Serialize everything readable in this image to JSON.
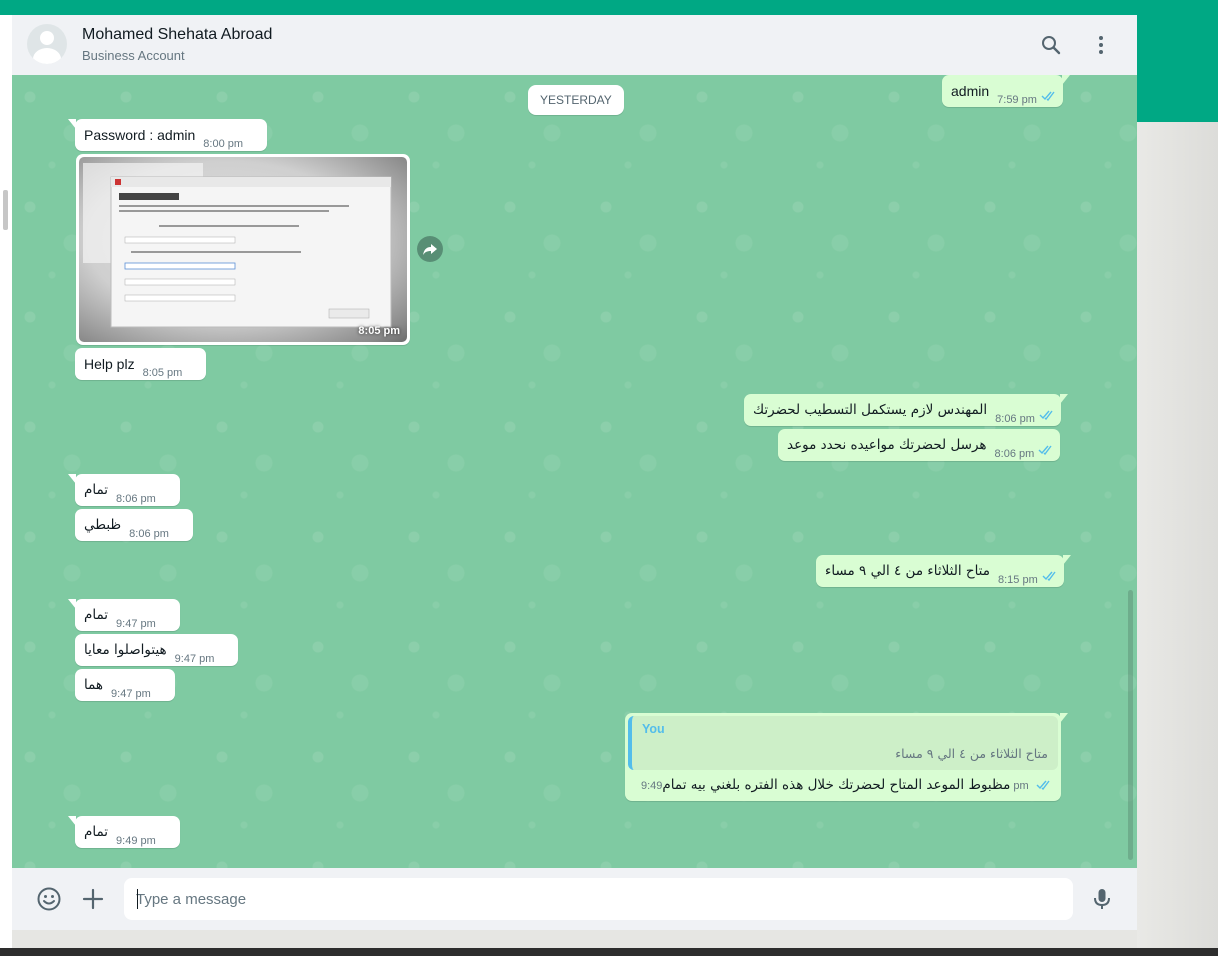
{
  "header": {
    "contact_name": "Mohamed Shehata Abroad",
    "contact_subtitle": "Business Account"
  },
  "chat": {
    "date_divider": "YESTERDAY",
    "messages": [
      {
        "dir": "out",
        "text": "admin",
        "time": "7:59 pm",
        "ticks": "read"
      },
      {
        "dir": "in",
        "text": "Password : admin",
        "time": "8:00 pm"
      },
      {
        "dir": "in",
        "type": "image",
        "time": "8:05 pm"
      },
      {
        "dir": "in",
        "text": "Help plz",
        "time": "8:05 pm"
      },
      {
        "dir": "out",
        "text": "المهندس لازم يستكمل التسطيب لحضرتك",
        "time": "8:06 pm",
        "ticks": "read"
      },
      {
        "dir": "out",
        "text": "هرسل لحضرتك مواعيده نحدد موعد",
        "time": "8:06 pm",
        "ticks": "read"
      },
      {
        "dir": "in",
        "text": "تمام",
        "time": "8:06 pm"
      },
      {
        "dir": "in",
        "text": "ظبطي",
        "time": "8:06 pm"
      },
      {
        "dir": "out",
        "text": "متاح الثلاثاء من ٤ الي ٩ مساء",
        "time": "8:15 pm",
        "ticks": "read"
      },
      {
        "dir": "in",
        "text": "تمام",
        "time": "9:47 pm"
      },
      {
        "dir": "in",
        "text": "هيتواصلوا معايا",
        "time": "9:47 pm"
      },
      {
        "dir": "in",
        "text": "هما",
        "time": "9:47 pm"
      },
      {
        "dir": "out",
        "text": "مظبوط الموعد المتاح لحضرتك خلال هذه الفتره بلغني بيه تمام",
        "time": "9:49 pm",
        "ticks": "read",
        "quoted": {
          "author": "You",
          "text": "متاح الثلاثاء من ٤ الي ٩ مساء"
        }
      },
      {
        "dir": "in",
        "text": "تمام",
        "time": "9:49 pm"
      }
    ]
  },
  "footer": {
    "input_placeholder": "Type a message"
  },
  "colors": {
    "brand": "#00a884",
    "outgoing_bubble": "#d9fdd3",
    "chat_background": "#7fcaa2",
    "read_ticks": "#53bdeb"
  },
  "icons": [
    "search-icon",
    "menu-icon",
    "forward-icon",
    "emoji-icon",
    "plus-icon",
    "mic-icon",
    "read-ticks-icon"
  ]
}
